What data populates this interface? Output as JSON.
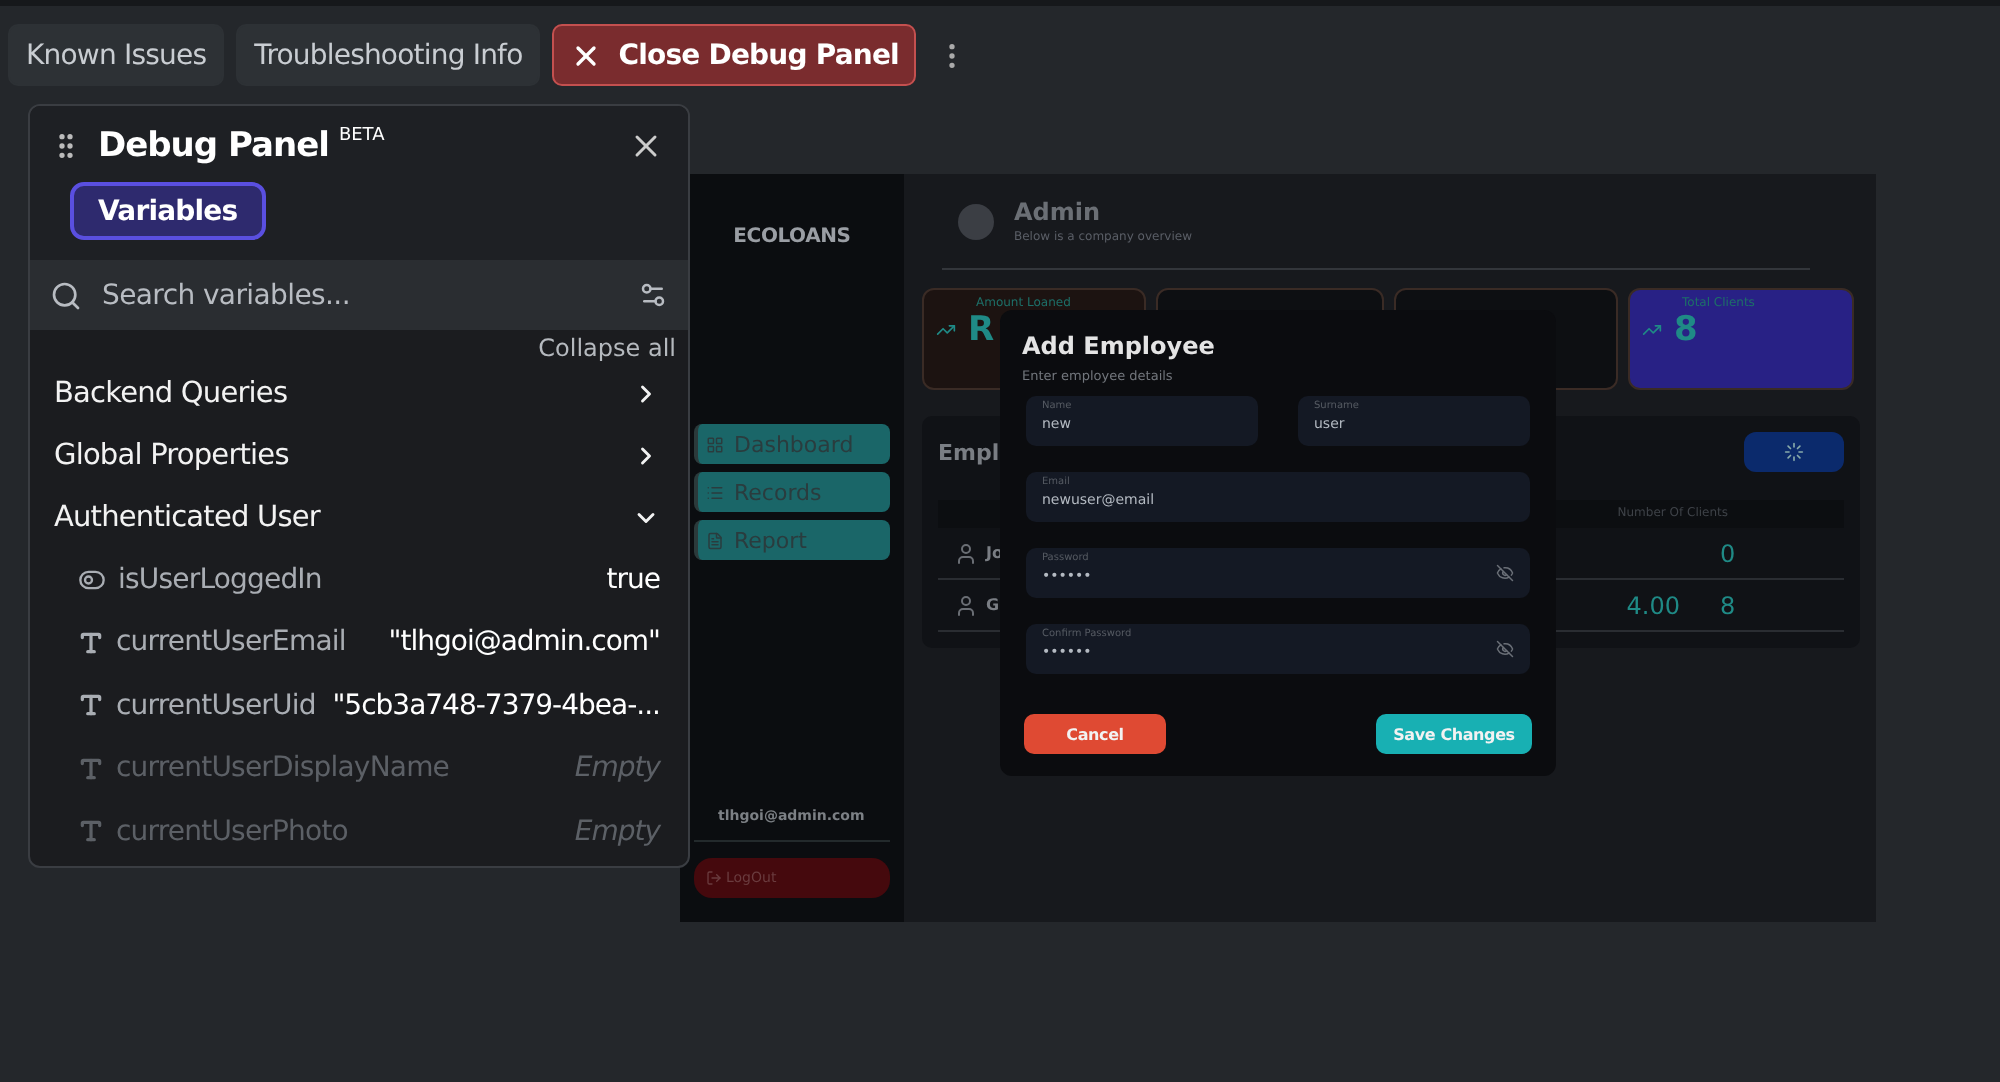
{
  "toolbar": {
    "buttons": [
      {
        "label": "Known Issues",
        "kind": "plain"
      },
      {
        "label": "Troubleshooting Info",
        "kind": "plain"
      },
      {
        "label": "Close Debug Panel",
        "kind": "danger"
      }
    ]
  },
  "debug_panel": {
    "title": "Debug Panel",
    "badge": "BETA",
    "tabs": [
      {
        "label": "Variables",
        "selected": true
      }
    ],
    "search": {
      "placeholder": "Search variables..."
    },
    "collapse_all": "Collapse all",
    "sections": [
      {
        "label": "Backend Queries",
        "expanded": false
      },
      {
        "label": "Global Properties",
        "expanded": false
      },
      {
        "label": "Authenticated User",
        "expanded": true,
        "children": [
          {
            "name": "isUserLoggedIn",
            "kind": "boolean",
            "value": "true",
            "empty": false
          },
          {
            "name": "currentUserEmail",
            "kind": "text",
            "value": "\"tlhgoi@admin.com\"",
            "empty": false
          },
          {
            "name": "currentUserUid",
            "kind": "text",
            "value": "\"5cb3a748-7379-4bea-...",
            "empty": false
          },
          {
            "name": "currentUserDisplayName",
            "kind": "text",
            "value": "Empty",
            "empty": true
          },
          {
            "name": "currentUserPhoto",
            "kind": "text",
            "value": "Empty",
            "empty": true
          }
        ]
      }
    ]
  },
  "preview": {
    "brand": "ECOLOANS",
    "nav": [
      {
        "label": "Dashboard",
        "kind": "grid"
      },
      {
        "label": "Records",
        "kind": "list"
      },
      {
        "label": "Report",
        "kind": "file"
      }
    ],
    "user_email": "tlhgoi@admin.com",
    "logout": "LogOut",
    "header": {
      "title": "Admin",
      "subtitle": "Below is a company overview"
    },
    "cards": [
      {
        "label": "Amount Loaned",
        "value": "R",
        "color": "#1c1311"
      },
      {
        "color": "#0d0f12"
      },
      {
        "color": "#0d0f12"
      },
      {
        "label": "Total Clients",
        "value": "8",
        "color": "#282185"
      }
    ],
    "employees": {
      "title": "Empl",
      "column": "Number Of Clients",
      "rows": [
        {
          "name": "Jo",
          "clients": "0"
        },
        {
          "name": "G",
          "amount": "4.00",
          "clients": "8"
        }
      ]
    },
    "modal": {
      "title": "Add Employee",
      "subtitle": "Enter employee details",
      "fields": [
        {
          "label": "Name",
          "value": "new",
          "kind": "half"
        },
        {
          "label": "Surname",
          "value": "user",
          "kind": "half"
        },
        {
          "label": "Email",
          "value": "newuser@email",
          "kind": "full"
        },
        {
          "label": "Password",
          "value": "••••••",
          "kind": "password"
        },
        {
          "label": "Confirm Password",
          "value": "••••••",
          "kind": "password"
        }
      ],
      "buttons": [
        {
          "label": "Cancel",
          "kind": "cancel"
        },
        {
          "label": "Save Changes",
          "kind": "save"
        }
      ]
    }
  }
}
